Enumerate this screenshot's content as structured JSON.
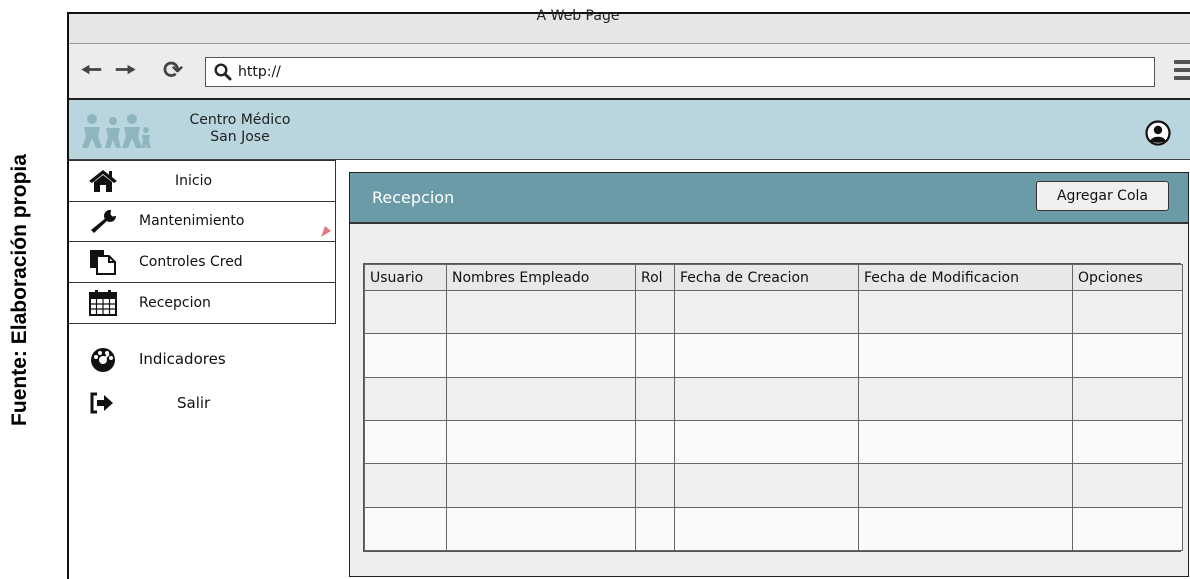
{
  "caption": "Fuente: Elaboración propia",
  "browser": {
    "title": "A Web Page",
    "url": "http://",
    "icons": [
      "back-arrow-icon",
      "forward-arrow-icon",
      "reload-icon",
      "search-icon",
      "hamburger-menu-icon"
    ]
  },
  "header": {
    "brand_line1": "Centro Médico",
    "brand_line2": "San Jose",
    "colors": {
      "header_bg": "#b9d6de",
      "logo": "#8fb5bf"
    }
  },
  "sidebar": {
    "items": [
      {
        "label": "Inicio",
        "icon": "home-icon"
      },
      {
        "label": "Mantenimiento",
        "icon": "wrench-icon"
      },
      {
        "label": "Controles Cred",
        "icon": "documents-icon"
      },
      {
        "label": "Recepcion",
        "icon": "calendar-icon"
      }
    ],
    "extra": [
      {
        "label": "Indicadores",
        "icon": "dashboard-icon"
      },
      {
        "label": "Salir",
        "icon": "sign-out-icon"
      }
    ]
  },
  "panel": {
    "title": "Recepcion",
    "add_button": "Agregar Cola",
    "color": "#6a9ba7"
  },
  "table": {
    "columns": [
      "Usuario",
      "Nombres Empleado",
      "Rol",
      "Fecha de Creacion",
      "Fecha de Modificacion",
      "Opciones"
    ],
    "rows": [
      [
        "",
        "",
        "",
        "",
        "",
        ""
      ],
      [
        "",
        "",
        "",
        "",
        "",
        ""
      ],
      [
        "",
        "",
        "",
        "",
        "",
        ""
      ],
      [
        "",
        "",
        "",
        "",
        "",
        ""
      ],
      [
        "",
        "",
        "",
        "",
        "",
        ""
      ],
      [
        "",
        "",
        "",
        "",
        "",
        ""
      ]
    ]
  }
}
